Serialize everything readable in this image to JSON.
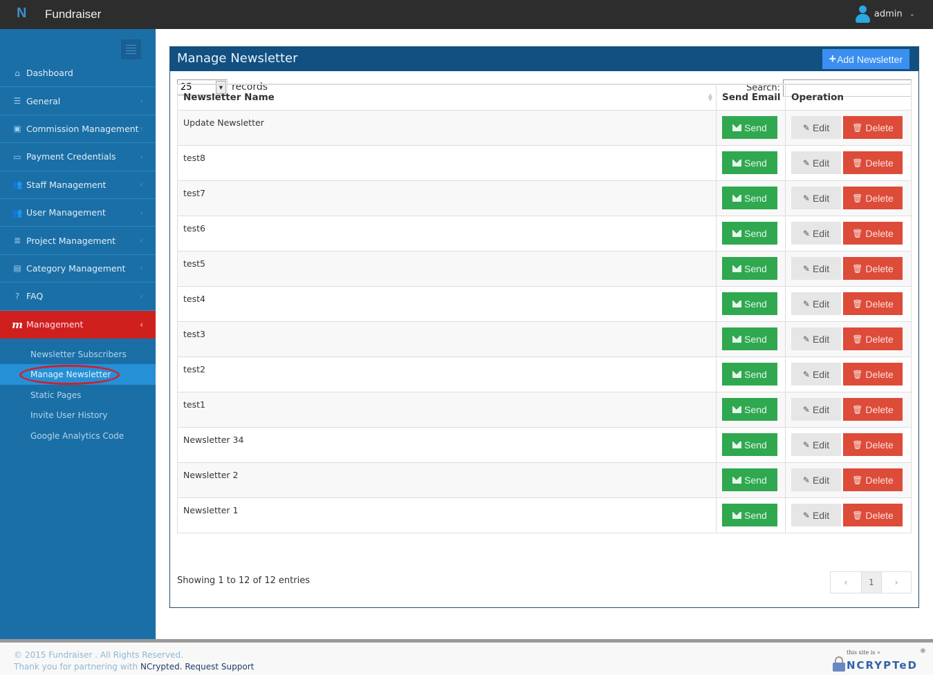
{
  "app": {
    "logo_letter": "N",
    "title": "Fundraiser",
    "user": "admin",
    "user_caret": "⌄"
  },
  "sidebar": {
    "items": [
      {
        "label": "Dashboard",
        "icon": "home-icon",
        "glyph": "⌂"
      },
      {
        "label": "General",
        "icon": "list-icon",
        "glyph": "☰"
      },
      {
        "label": "Commission Management",
        "icon": "money-icon",
        "glyph": "▣"
      },
      {
        "label": "Payment Credentials",
        "icon": "credit-card-icon",
        "glyph": "▭"
      },
      {
        "label": "Staff Management",
        "icon": "users-icon",
        "glyph": "👥"
      },
      {
        "label": "User Management",
        "icon": "users-icon",
        "glyph": "👥"
      },
      {
        "label": "Project Management",
        "icon": "list-icon",
        "glyph": "≣"
      },
      {
        "label": "Category Management",
        "icon": "list-alt-icon",
        "glyph": "▤"
      },
      {
        "label": "FAQ",
        "icon": "question-circle-icon",
        "glyph": "?"
      },
      {
        "label": "Management",
        "icon": "m-icon",
        "glyph": "m"
      }
    ],
    "chevron": "‹",
    "submenu": [
      {
        "label": "Newsletter Subscribers"
      },
      {
        "label": "Manage Newsletter"
      },
      {
        "label": "Static Pages"
      },
      {
        "label": "Invite User History"
      },
      {
        "label": "Google Analytics Code"
      }
    ]
  },
  "panel": {
    "title": "Manage Newsletter",
    "add_button": "Add Newsletter",
    "records_value": "25",
    "records_label": "records",
    "search_label": "Search:",
    "search_value": "",
    "columns": [
      "Newsletter Name",
      "Send Email",
      "Operation"
    ],
    "rows": [
      {
        "name": "Update Newsletter"
      },
      {
        "name": "test8"
      },
      {
        "name": "test7"
      },
      {
        "name": "test6"
      },
      {
        "name": "test5"
      },
      {
        "name": "test4"
      },
      {
        "name": "test3"
      },
      {
        "name": "test2"
      },
      {
        "name": "test1"
      },
      {
        "name": "Newsletter 34"
      },
      {
        "name": "Newsletter 2"
      },
      {
        "name": "Newsletter 1"
      }
    ],
    "send_label": "Send",
    "edit_label": "Edit",
    "delete_label": "Delete",
    "info": "Showing 1 to 12 of 12 entries",
    "pager": {
      "prev": "‹",
      "current": "1",
      "next": "›"
    }
  },
  "footer": {
    "copyright": "© 2015 Fundraiser . All Rights Reserved.",
    "thanks": "Thank you for partnering with ",
    "link1": "NCrypted",
    "sep": ". ",
    "link2": "Request Support",
    "badge_small": "this site is »",
    "badge_big": "NCRYPTeD",
    "badge_reg": "®"
  },
  "colors": {
    "topbar": "#2d2d2d",
    "sidebar": "#1a6fa6",
    "active_menu": "#d0201e",
    "panel_header": "#125081",
    "add_button": "#3b8ff0",
    "send": "#2fa84f",
    "delete": "#dd4b39",
    "edit": "#e6e6e6"
  }
}
